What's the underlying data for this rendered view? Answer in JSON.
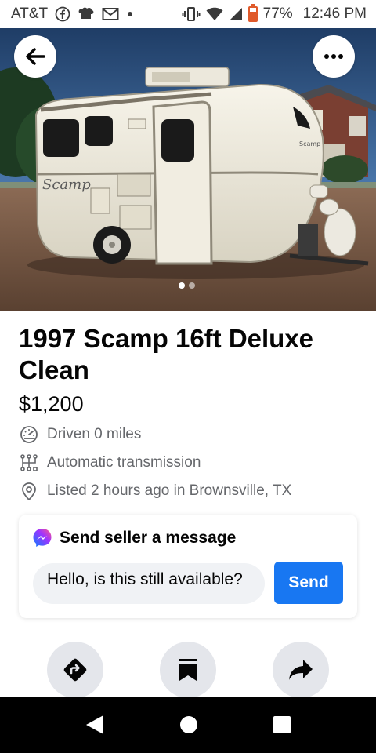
{
  "status_bar": {
    "carrier": "AT&T",
    "battery": "77%",
    "time": "12:46 PM",
    "icons": [
      "facebook-icon",
      "chef-hat-icon",
      "gmail-icon",
      "dot-icon",
      "vibrate-icon",
      "wifi-icon",
      "signal-icon",
      "battery-icon"
    ]
  },
  "hero": {
    "photo_subject": "trailer-photo",
    "trailer_badge": "Scamp",
    "trailer_logo_side": "Scamp",
    "total_photos": 2,
    "current_photo": 1
  },
  "listing": {
    "title": "1997 Scamp 16ft Deluxe Clean",
    "price": "$1,200",
    "details": [
      {
        "icon": "speedometer-icon",
        "text": "Driven 0 miles"
      },
      {
        "icon": "transmission-icon",
        "text": "Automatic transmission"
      },
      {
        "icon": "location-pin-icon",
        "text": "Listed 2 hours ago in Brownsville, TX"
      }
    ]
  },
  "message": {
    "header": "Send seller a message",
    "input_value": "Hello, is this still available?",
    "send_label": "Send"
  },
  "actions": [
    "directions-icon",
    "bookmark-icon",
    "share-icon"
  ],
  "nav": [
    "back-nav-icon",
    "home-nav-icon",
    "recents-nav-icon"
  ],
  "colors": {
    "accent": "#1877f2",
    "secondary_text": "#65676b",
    "action_bg": "#e4e6eb"
  }
}
